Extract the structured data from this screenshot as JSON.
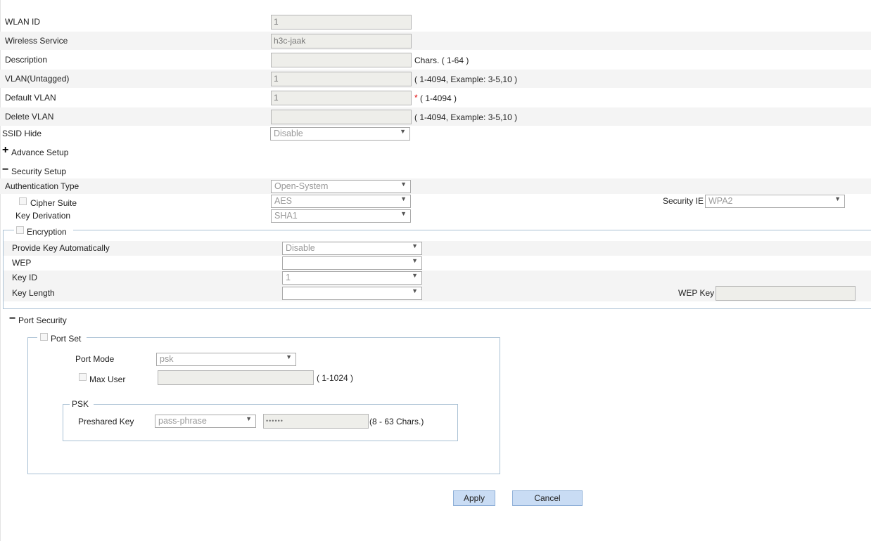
{
  "basic": {
    "wlan_id_label": "WLAN ID",
    "wlan_id_value": "1",
    "wireless_service_label": "Wireless Service",
    "wireless_service_value": "h3c-jaak",
    "description_label": "Description",
    "description_value": "",
    "description_hint": "Chars. ( 1-64 )",
    "vlan_untagged_label": "VLAN(Untagged)",
    "vlan_untagged_value": "1",
    "vlan_untagged_hint": "( 1-4094, Example: 3-5,10 )",
    "default_vlan_label": "Default VLAN",
    "default_vlan_value": "1",
    "default_vlan_required": "*",
    "default_vlan_hint": "( 1-4094 )",
    "delete_vlan_label": "Delete VLAN",
    "delete_vlan_value": "",
    "delete_vlan_hint": "( 1-4094, Example: 3-5,10 )",
    "ssid_hide_label": "SSID Hide",
    "ssid_hide_value": "Disable"
  },
  "sections": {
    "advance_setup_symbol": "+",
    "advance_setup_label": "Advance Setup",
    "security_setup_symbol": "−",
    "security_setup_label": "Security Setup",
    "port_security_symbol": "−",
    "port_security_label": "Port Security"
  },
  "security": {
    "auth_type_label": "Authentication Type",
    "auth_type_value": "Open-System",
    "cipher_suite_label": "Cipher Suite",
    "cipher_suite_value": "AES",
    "security_ie_label": "Security IE",
    "security_ie_value": "WPA2",
    "key_derivation_label": "Key Derivation",
    "key_derivation_value": "SHA1"
  },
  "encryption": {
    "legend": "Encryption",
    "provide_key_label": "Provide Key Automatically",
    "provide_key_value": "Disable",
    "wep_label": "WEP",
    "wep_value": "",
    "key_id_label": "Key ID",
    "key_id_value": "1",
    "key_length_label": "Key Length",
    "key_length_value": "",
    "wep_key_label": "WEP Key",
    "wep_key_value": ""
  },
  "port_set": {
    "legend": "Port Set",
    "port_mode_label": "Port Mode",
    "port_mode_value": "psk",
    "max_user_label": "Max User",
    "max_user_value": "",
    "max_user_hint": "( 1-1024 )",
    "psk_legend": "PSK",
    "preshared_key_label": "Preshared Key",
    "preshared_key_type": "pass-phrase",
    "preshared_key_value": "••••••",
    "preshared_key_hint": "(8 - 63 Chars.)"
  },
  "actions": {
    "apply_label": "Apply",
    "cancel_label": "Cancel"
  },
  "icons": {
    "dropdown_arrow": "▼"
  }
}
